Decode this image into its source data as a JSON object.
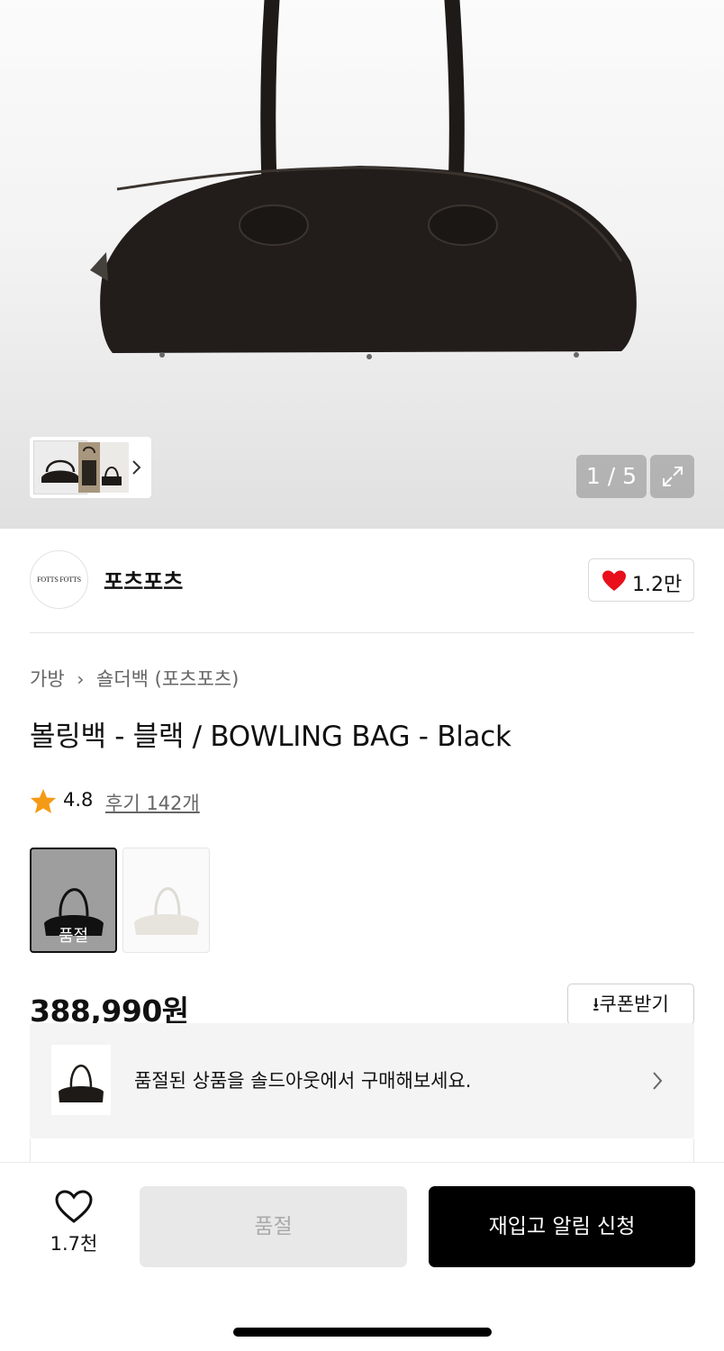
{
  "gallery": {
    "counter": "1 / 5",
    "icons": {
      "next": "chevron-right-icon",
      "expand": "expand-arrows-icon"
    }
  },
  "brand": {
    "logo_text": "FOTTS FOTTS",
    "name": "포츠포츠",
    "like_count": "1.2만",
    "like_color": "#e8101b"
  },
  "product": {
    "breadcrumb": [
      "가방",
      "숄더백 (포츠포츠)"
    ],
    "title": "볼링백 - 블랙 / BOWLING BAG - Black",
    "rating": {
      "score": "4.8",
      "reviews": "후기 142개",
      "star_color": "#f59a15"
    },
    "swatches": [
      {
        "color": "Black",
        "label": "품절",
        "selected": true
      },
      {
        "color": "White",
        "label": "",
        "selected": false
      }
    ],
    "price": "388,990원",
    "coupon_label": "쿠폰받기"
  },
  "soldout_banner": {
    "text": "품절된 상품을 솔드아웃에서 구매해보세요."
  },
  "bottom_bar": {
    "wish_count": "1.7천",
    "soldout_label": "품절",
    "restock_label": "재입고 알림 신청"
  }
}
